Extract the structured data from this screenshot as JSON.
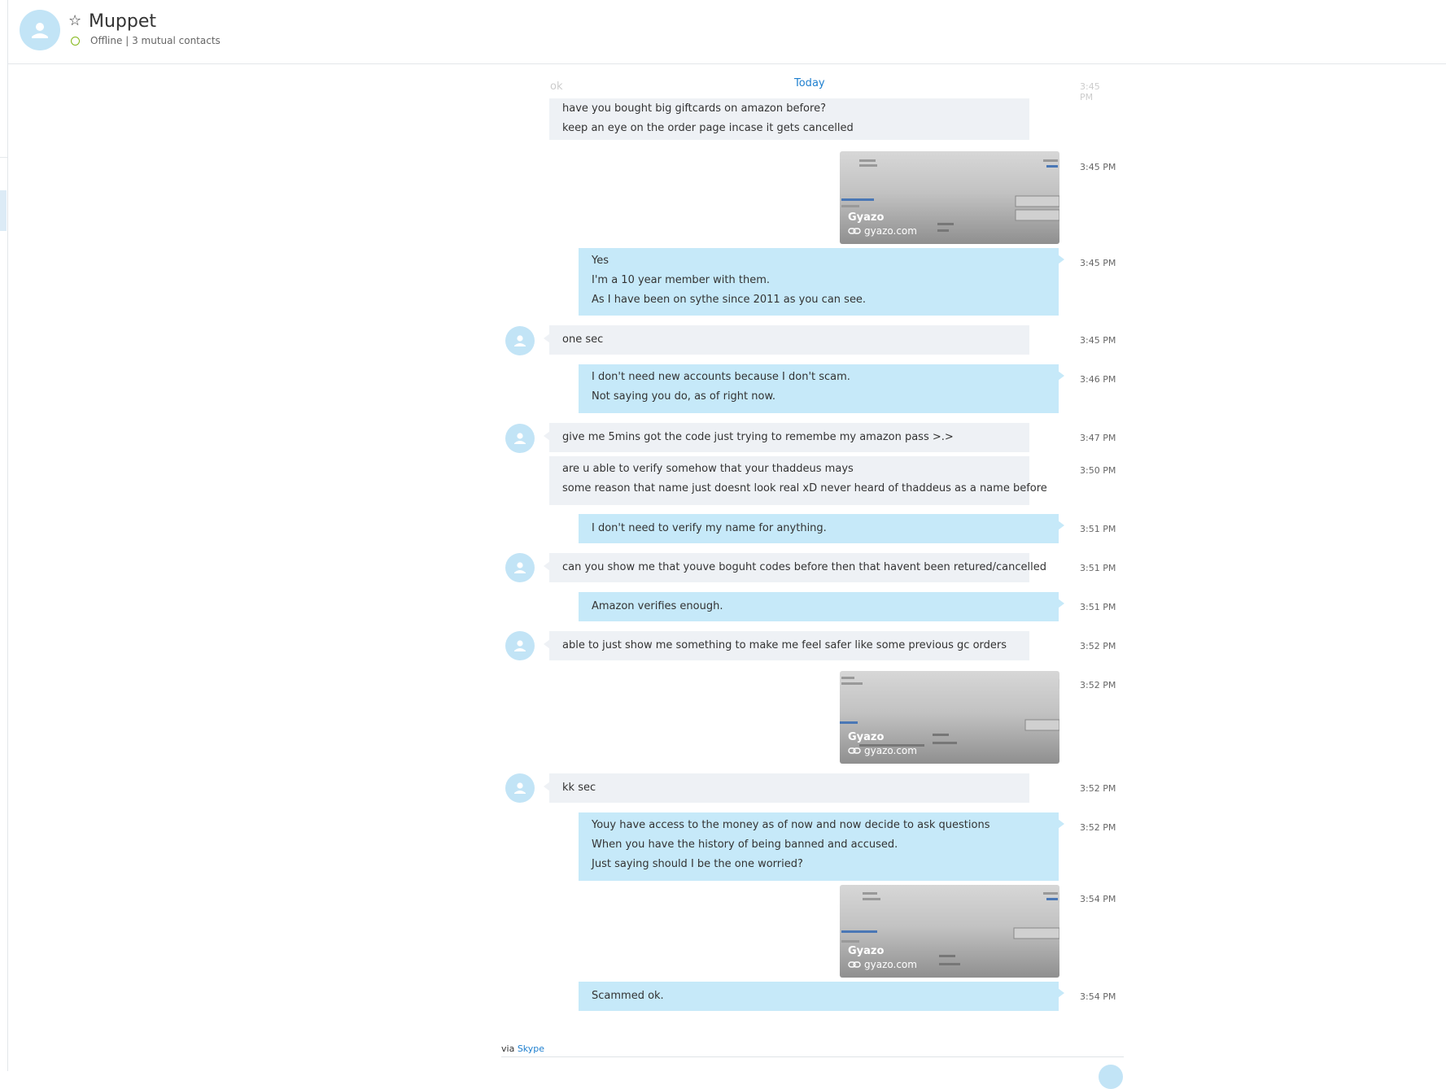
{
  "header": {
    "contact_name": "Muppet",
    "presence": "Offline",
    "separator": "|",
    "mutual": "3 mutual contacts"
  },
  "chat": {
    "day_label": "Today",
    "ghost_text": "ok",
    "ghost_time": "3:45 PM",
    "msg1": {
      "lines": [
        "have you bought big giftcards on amazon before?",
        "keep an eye on the order page incase it gets cancelled"
      ]
    },
    "img1": {
      "brand": "Gyazo",
      "domain": "gyazo.com",
      "time": "3:45 PM"
    },
    "msg2": {
      "lines": [
        "Yes",
        "I'm a 10 year member with them.",
        "As I have been on sythe since 2011 as you can see."
      ],
      "time": "3:45 PM"
    },
    "msg3": {
      "lines": [
        "one sec"
      ],
      "time": "3:45 PM"
    },
    "msg4": {
      "lines": [
        "I don't need new accounts because I don't scam.",
        "Not saying you do, as of right now."
      ],
      "time": "3:46 PM"
    },
    "msg5": {
      "lines": [
        "give me 5mins got the code just trying to remembe my amazon pass >.>"
      ],
      "time": "3:47 PM"
    },
    "msg6": {
      "lines": [
        "are u able to verify somehow that your thaddeus mays",
        "some reason that name just doesnt look real xD never heard of thaddeus as a name before"
      ],
      "time": "3:50 PM"
    },
    "msg7": {
      "lines": [
        "I don't need to verify my name for anything."
      ],
      "time": "3:51 PM"
    },
    "msg8": {
      "lines": [
        "can you show me that youve boguht codes before then that havent been retured/cancelled"
      ],
      "time": "3:51 PM"
    },
    "msg9": {
      "lines": [
        "Amazon verifies enough."
      ],
      "time": "3:51 PM"
    },
    "msg10": {
      "lines": [
        "able to just show me something to make me feel safer like some previous gc orders"
      ],
      "time": "3:52 PM"
    },
    "img2": {
      "brand": "Gyazo",
      "domain": "gyazo.com",
      "time": "3:52 PM"
    },
    "msg11": {
      "lines": [
        "kk sec"
      ],
      "time": "3:52 PM"
    },
    "msg12": {
      "lines": [
        "Youy have access to the money as of now and now decide to ask questions",
        "When you have the history of being banned and accused.",
        "Just saying should I be the one worried?"
      ],
      "time": "3:52 PM"
    },
    "img3": {
      "brand": "Gyazo",
      "domain": "gyazo.com",
      "time": "3:54 PM"
    },
    "msg13": {
      "lines": [
        "Scammed ok."
      ],
      "time": "3:54 PM"
    }
  },
  "footer": {
    "via": "via",
    "service": "Skype"
  },
  "colors": {
    "accent": "#1e7fcf",
    "outgoing_bubble": "#c6e9f9",
    "incoming_bubble": "#eef1f5",
    "presence_offline": "#84b818"
  }
}
